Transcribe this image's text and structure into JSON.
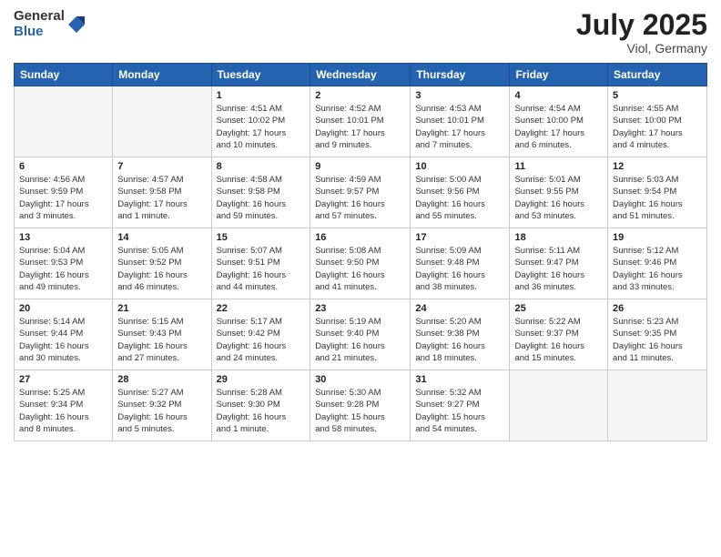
{
  "logo": {
    "general": "General",
    "blue": "Blue"
  },
  "header": {
    "month": "July 2025",
    "location": "Viol, Germany"
  },
  "weekdays": [
    "Sunday",
    "Monday",
    "Tuesday",
    "Wednesday",
    "Thursday",
    "Friday",
    "Saturday"
  ],
  "weeks": [
    [
      {
        "day": "",
        "info": ""
      },
      {
        "day": "",
        "info": ""
      },
      {
        "day": "1",
        "info": "Sunrise: 4:51 AM\nSunset: 10:02 PM\nDaylight: 17 hours\nand 10 minutes."
      },
      {
        "day": "2",
        "info": "Sunrise: 4:52 AM\nSunset: 10:01 PM\nDaylight: 17 hours\nand 9 minutes."
      },
      {
        "day": "3",
        "info": "Sunrise: 4:53 AM\nSunset: 10:01 PM\nDaylight: 17 hours\nand 7 minutes."
      },
      {
        "day": "4",
        "info": "Sunrise: 4:54 AM\nSunset: 10:00 PM\nDaylight: 17 hours\nand 6 minutes."
      },
      {
        "day": "5",
        "info": "Sunrise: 4:55 AM\nSunset: 10:00 PM\nDaylight: 17 hours\nand 4 minutes."
      }
    ],
    [
      {
        "day": "6",
        "info": "Sunrise: 4:56 AM\nSunset: 9:59 PM\nDaylight: 17 hours\nand 3 minutes."
      },
      {
        "day": "7",
        "info": "Sunrise: 4:57 AM\nSunset: 9:58 PM\nDaylight: 17 hours\nand 1 minute."
      },
      {
        "day": "8",
        "info": "Sunrise: 4:58 AM\nSunset: 9:58 PM\nDaylight: 16 hours\nand 59 minutes."
      },
      {
        "day": "9",
        "info": "Sunrise: 4:59 AM\nSunset: 9:57 PM\nDaylight: 16 hours\nand 57 minutes."
      },
      {
        "day": "10",
        "info": "Sunrise: 5:00 AM\nSunset: 9:56 PM\nDaylight: 16 hours\nand 55 minutes."
      },
      {
        "day": "11",
        "info": "Sunrise: 5:01 AM\nSunset: 9:55 PM\nDaylight: 16 hours\nand 53 minutes."
      },
      {
        "day": "12",
        "info": "Sunrise: 5:03 AM\nSunset: 9:54 PM\nDaylight: 16 hours\nand 51 minutes."
      }
    ],
    [
      {
        "day": "13",
        "info": "Sunrise: 5:04 AM\nSunset: 9:53 PM\nDaylight: 16 hours\nand 49 minutes."
      },
      {
        "day": "14",
        "info": "Sunrise: 5:05 AM\nSunset: 9:52 PM\nDaylight: 16 hours\nand 46 minutes."
      },
      {
        "day": "15",
        "info": "Sunrise: 5:07 AM\nSunset: 9:51 PM\nDaylight: 16 hours\nand 44 minutes."
      },
      {
        "day": "16",
        "info": "Sunrise: 5:08 AM\nSunset: 9:50 PM\nDaylight: 16 hours\nand 41 minutes."
      },
      {
        "day": "17",
        "info": "Sunrise: 5:09 AM\nSunset: 9:48 PM\nDaylight: 16 hours\nand 38 minutes."
      },
      {
        "day": "18",
        "info": "Sunrise: 5:11 AM\nSunset: 9:47 PM\nDaylight: 16 hours\nand 36 minutes."
      },
      {
        "day": "19",
        "info": "Sunrise: 5:12 AM\nSunset: 9:46 PM\nDaylight: 16 hours\nand 33 minutes."
      }
    ],
    [
      {
        "day": "20",
        "info": "Sunrise: 5:14 AM\nSunset: 9:44 PM\nDaylight: 16 hours\nand 30 minutes."
      },
      {
        "day": "21",
        "info": "Sunrise: 5:15 AM\nSunset: 9:43 PM\nDaylight: 16 hours\nand 27 minutes."
      },
      {
        "day": "22",
        "info": "Sunrise: 5:17 AM\nSunset: 9:42 PM\nDaylight: 16 hours\nand 24 minutes."
      },
      {
        "day": "23",
        "info": "Sunrise: 5:19 AM\nSunset: 9:40 PM\nDaylight: 16 hours\nand 21 minutes."
      },
      {
        "day": "24",
        "info": "Sunrise: 5:20 AM\nSunset: 9:38 PM\nDaylight: 16 hours\nand 18 minutes."
      },
      {
        "day": "25",
        "info": "Sunrise: 5:22 AM\nSunset: 9:37 PM\nDaylight: 16 hours\nand 15 minutes."
      },
      {
        "day": "26",
        "info": "Sunrise: 5:23 AM\nSunset: 9:35 PM\nDaylight: 16 hours\nand 11 minutes."
      }
    ],
    [
      {
        "day": "27",
        "info": "Sunrise: 5:25 AM\nSunset: 9:34 PM\nDaylight: 16 hours\nand 8 minutes."
      },
      {
        "day": "28",
        "info": "Sunrise: 5:27 AM\nSunset: 9:32 PM\nDaylight: 16 hours\nand 5 minutes."
      },
      {
        "day": "29",
        "info": "Sunrise: 5:28 AM\nSunset: 9:30 PM\nDaylight: 16 hours\nand 1 minute."
      },
      {
        "day": "30",
        "info": "Sunrise: 5:30 AM\nSunset: 9:28 PM\nDaylight: 15 hours\nand 58 minutes."
      },
      {
        "day": "31",
        "info": "Sunrise: 5:32 AM\nSunset: 9:27 PM\nDaylight: 15 hours\nand 54 minutes."
      },
      {
        "day": "",
        "info": ""
      },
      {
        "day": "",
        "info": ""
      }
    ]
  ]
}
